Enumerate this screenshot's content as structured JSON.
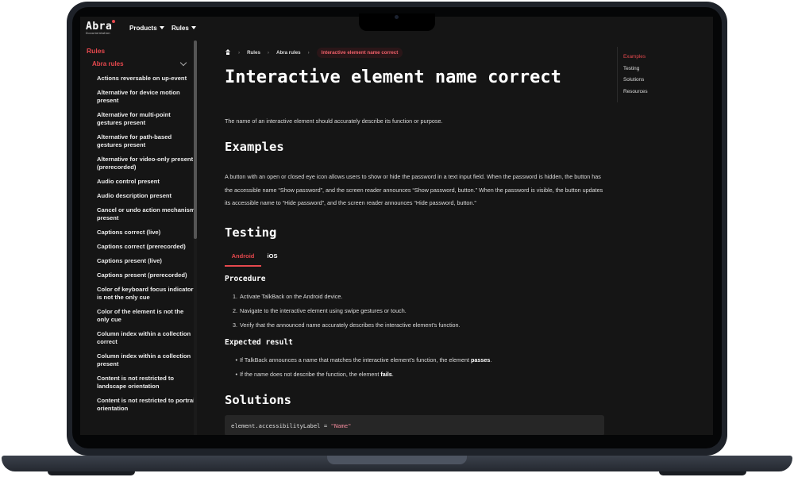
{
  "header": {
    "logo_name": "Abra",
    "logo_sub": "Documentation",
    "nav": [
      {
        "label": "Products"
      },
      {
        "label": "Rules"
      }
    ]
  },
  "sidebar": {
    "title": "Rules",
    "group": "Abra rules",
    "items": [
      {
        "label": "Actions reversable on up-event"
      },
      {
        "label": "Alternative for device motion present"
      },
      {
        "label": "Alternative for multi-point gestures present"
      },
      {
        "label": "Alternative for path-based gestures present"
      },
      {
        "label": "Alternative for video-only present (prerecorded)"
      },
      {
        "label": "Audio control present"
      },
      {
        "label": "Audio description present"
      },
      {
        "label": "Cancel or undo action mechanism present"
      },
      {
        "label": "Captions correct (live)"
      },
      {
        "label": "Captions correct (prerecorded)"
      },
      {
        "label": "Captions present (live)"
      },
      {
        "label": "Captions present (prerecorded)"
      },
      {
        "label": "Color of keyboard focus indicator is not the only cue"
      },
      {
        "label": "Color of the element is not the only cue"
      },
      {
        "label": "Column index within a collection correct"
      },
      {
        "label": "Column index within a collection present"
      },
      {
        "label": "Content is not restricted to landscape orientation"
      },
      {
        "label": "Content is not restricted to portrait orientation"
      }
    ]
  },
  "breadcrumb": {
    "items": [
      "Rules",
      "Abra rules"
    ],
    "current": "Interactive element name correct"
  },
  "main": {
    "title": "Interactive element name correct",
    "intro": "The name of an interactive element should accurately describe its function or purpose.",
    "examples_heading": "Examples",
    "examples_text": "A button with an open or closed eye icon allows users to show or hide the password in a text input field. When the password is hidden, the button has the accessible name “Show password”, and the screen reader announces “Show password, button.” When the password is visible, the button updates its accessible name to “Hide password”, and the screen reader announces “Hide password, button.”",
    "testing_heading": "Testing",
    "tabs": [
      {
        "label": "Android",
        "active": true
      },
      {
        "label": "iOS",
        "active": false
      }
    ],
    "procedure_heading": "Procedure",
    "procedure_steps": [
      {
        "num": "1.",
        "text": "Activate TalkBack on the Android device."
      },
      {
        "num": "2.",
        "text": "Navigate to the interactive element using swipe gestures or touch."
      },
      {
        "num": "3.",
        "text": "Verify that the announced name accurately describes the interactive element’s function."
      }
    ],
    "expected_heading": "Expected result",
    "expected": [
      {
        "text": "If TalkBack announces a name that matches the interactive element’s function, the element ",
        "bold": "passes",
        "end": "."
      },
      {
        "text": "If the name does not describe the function, the element ",
        "bold": "fails",
        "end": "."
      }
    ],
    "solutions_heading": "Solutions",
    "code": {
      "prefix": "element.accessibilityLabel = ",
      "string": "\"Name\""
    }
  },
  "toc": {
    "items": [
      {
        "label": "Examples",
        "active": true
      },
      {
        "label": "Testing",
        "active": false
      },
      {
        "label": "Solutions",
        "active": false
      },
      {
        "label": "Resources",
        "active": false
      }
    ]
  },
  "colors": {
    "accent": "#e5484d",
    "background": "#151515",
    "code_background": "#262626",
    "frame": "#1e2229"
  }
}
